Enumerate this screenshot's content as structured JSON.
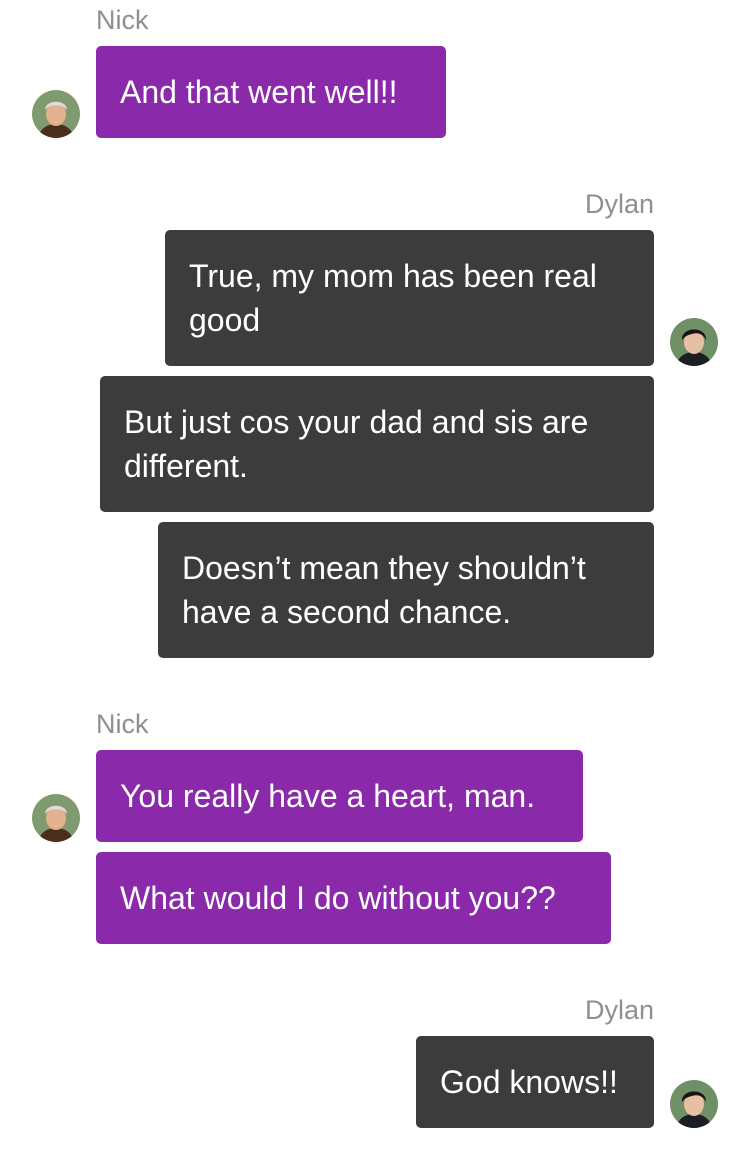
{
  "conversation": {
    "group1": {
      "sender": "Nick",
      "messages": [
        "And that went well!!"
      ]
    },
    "group2": {
      "sender": "Dylan",
      "messages": [
        "True, my mom has been real good",
        "But just cos your dad and sis are different.",
        "Doesn’t mean they shouldn’t have a second chance."
      ]
    },
    "group3": {
      "sender": "Nick",
      "messages": [
        "You really have a heart, man.",
        "What would I do without you??"
      ]
    },
    "group4": {
      "sender": "Dylan",
      "messages": [
        "God knows!!"
      ]
    }
  },
  "colors": {
    "nick_bubble": "#8a2aaa",
    "dylan_bubble": "#3c3c3c",
    "sender_label": "#8e8e93"
  },
  "avatars": {
    "nick": "nick-avatar",
    "dylan": "dylan-avatar"
  }
}
